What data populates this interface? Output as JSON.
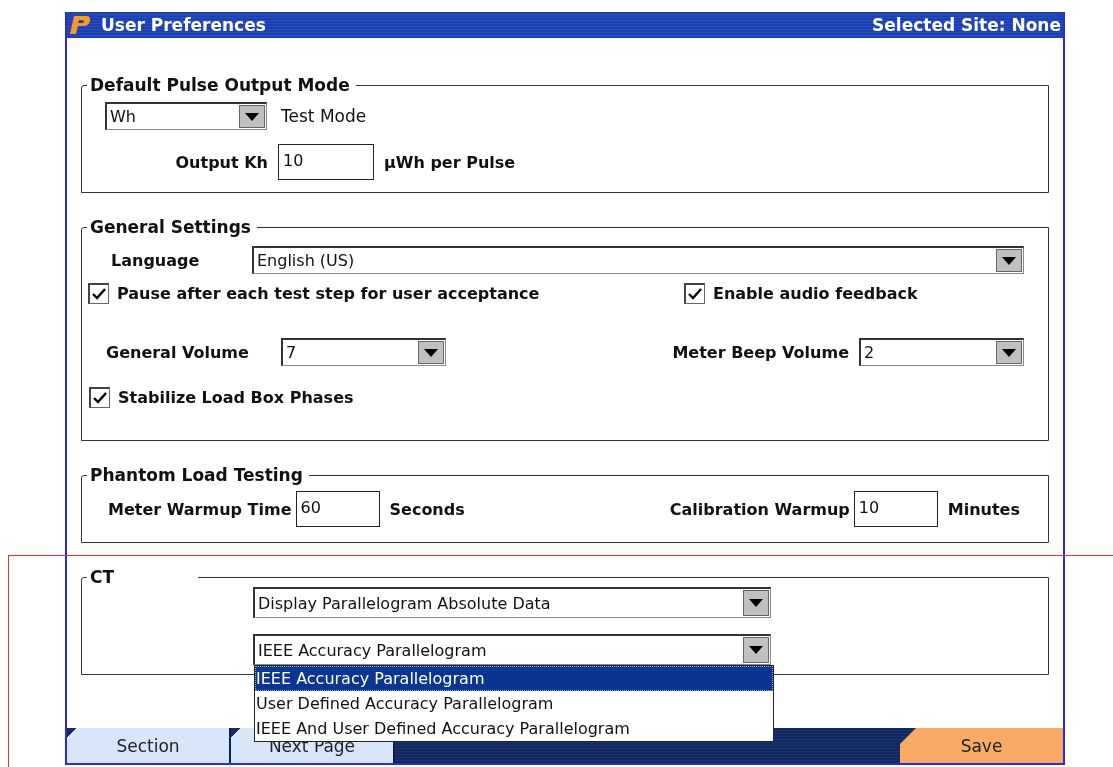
{
  "window": {
    "title": "User Preferences",
    "site_status": "Selected Site: None"
  },
  "pulse_output": {
    "title": "Default Pulse Output Mode",
    "mode_select": {
      "value": "Wh"
    },
    "mode_label": "Test Mode",
    "kh_label": "Output Kh",
    "kh_value": "10",
    "kh_unit": "µWh per Pulse"
  },
  "general_settings": {
    "title": "General Settings",
    "language_label": "Language",
    "language_select": {
      "value": "English (US)"
    },
    "checkboxes": [
      {
        "label": "Pause after each test step for user acceptance",
        "checked": true
      },
      {
        "label": "Enable audio feedback",
        "checked": true
      },
      {
        "label": "Stabilize Load Box Phases",
        "checked": true
      }
    ],
    "general_volume_label": "General Volume",
    "general_volume_select": {
      "value": "7"
    },
    "beep_volume_label": "Meter Beep Volume",
    "beep_volume_select": {
      "value": "2"
    }
  },
  "phantom_load": {
    "title": "Phantom Load Testing",
    "fields": [
      {
        "label": "Meter Warmup Time",
        "value": "60",
        "unit": "Seconds"
      },
      {
        "label": "Calibration Warmup",
        "value": "10",
        "unit": "Minutes"
      }
    ]
  },
  "ct": {
    "title": "CT",
    "selects": [
      {
        "value": "Display Parallelogram Absolute Data"
      },
      {
        "value": "IEEE Accuracy Parallelogram",
        "expanded": true,
        "options": [
          {
            "label": "IEEE Accuracy Parallelogram",
            "selected": true
          },
          {
            "label": "User Defined Accuracy Parallelogram",
            "selected": false
          },
          {
            "label": "IEEE And User Defined Accuracy Parallelogram",
            "selected": false
          }
        ]
      }
    ]
  },
  "bottom_bar": {
    "buttons": [
      {
        "label": "Section",
        "kind": "tab"
      },
      {
        "label": "Next Page",
        "kind": "tab"
      },
      {
        "label": "Save",
        "kind": "primary"
      }
    ]
  }
}
